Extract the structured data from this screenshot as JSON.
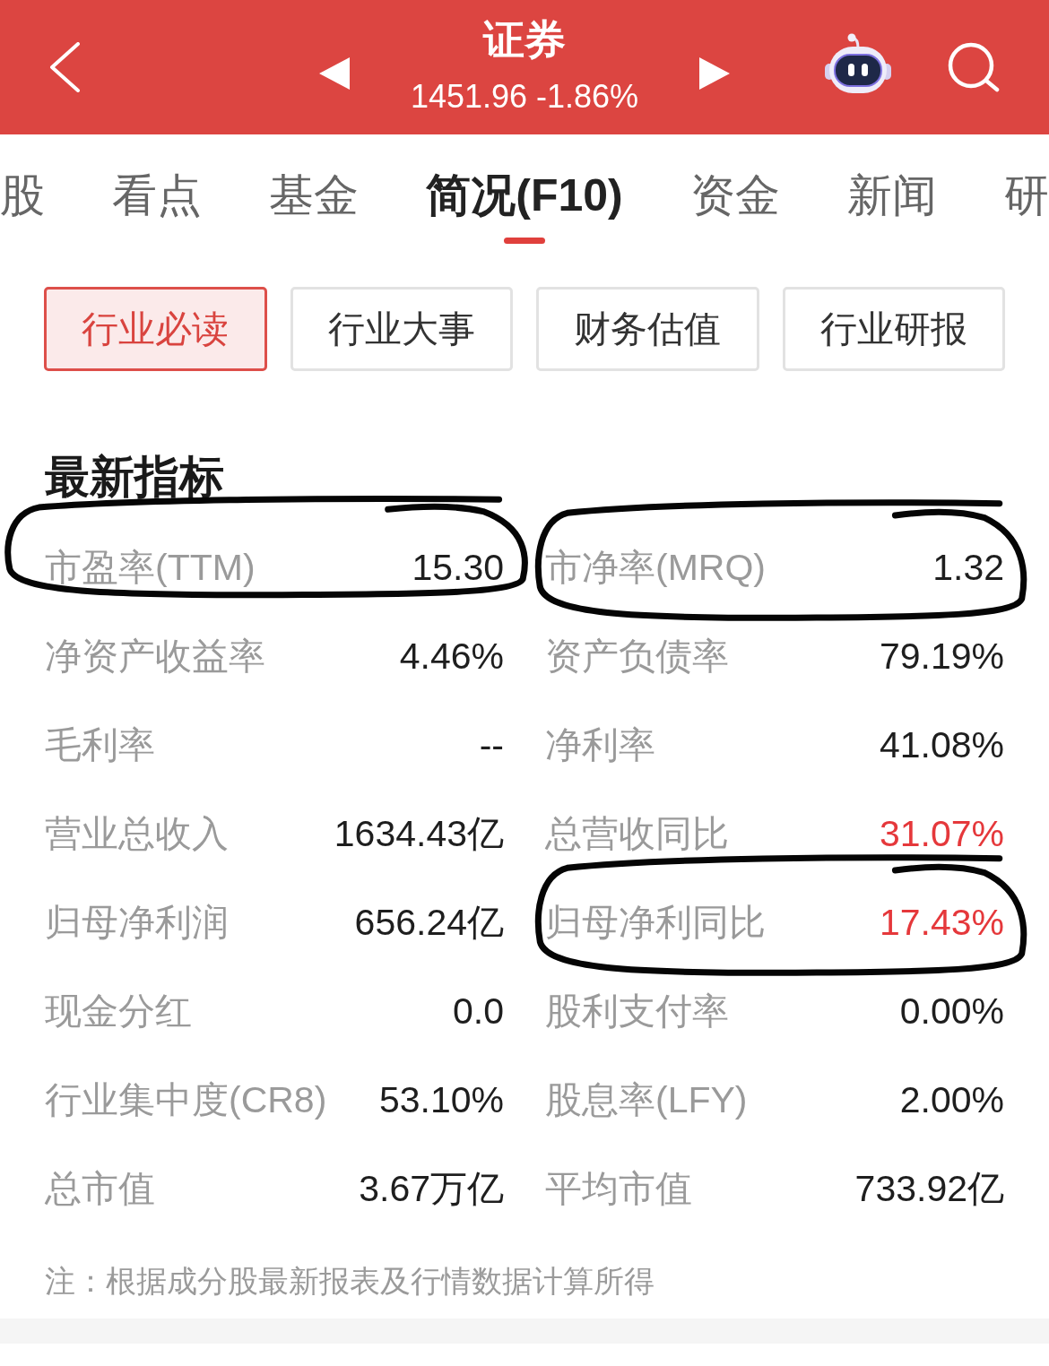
{
  "header": {
    "title": "证券",
    "quote": "1451.96 -1.86%"
  },
  "tabs": [
    {
      "label": "股",
      "selected": false
    },
    {
      "label": "看点",
      "selected": false
    },
    {
      "label": "基金",
      "selected": false
    },
    {
      "label": "简况(F10)",
      "selected": true
    },
    {
      "label": "资金",
      "selected": false
    },
    {
      "label": "新闻",
      "selected": false
    },
    {
      "label": "研",
      "selected": false
    }
  ],
  "sub_tabs": [
    {
      "label": "行业必读",
      "selected": true
    },
    {
      "label": "行业大事",
      "selected": false
    },
    {
      "label": "财务估值",
      "selected": false
    },
    {
      "label": "行业研报",
      "selected": false
    }
  ],
  "section": {
    "title": "最新指标",
    "metrics": [
      {
        "label": "市盈率(TTM)",
        "value": "15.30",
        "rising": false,
        "circled": true
      },
      {
        "label": "市净率(MRQ)",
        "value": "1.32",
        "rising": false,
        "circled": true
      },
      {
        "label": "净资产收益率",
        "value": "4.46%",
        "rising": false,
        "circled": false
      },
      {
        "label": "资产负债率",
        "value": "79.19%",
        "rising": false,
        "circled": false
      },
      {
        "label": "毛利率",
        "value": "--",
        "rising": false,
        "circled": false
      },
      {
        "label": "净利率",
        "value": "41.08%",
        "rising": false,
        "circled": false
      },
      {
        "label": "营业总收入",
        "value": "1634.43亿",
        "rising": false,
        "circled": false
      },
      {
        "label": "总营收同比",
        "value": "31.07%",
        "rising": true,
        "circled": false
      },
      {
        "label": "归母净利润",
        "value": "656.24亿",
        "rising": false,
        "circled": false
      },
      {
        "label": "归母净利同比",
        "value": "17.43%",
        "rising": true,
        "circled": true
      },
      {
        "label": "现金分红",
        "value": "0.0",
        "rising": false,
        "circled": false
      },
      {
        "label": "股利支付率",
        "value": "0.00%",
        "rising": false,
        "circled": false
      },
      {
        "label": "行业集中度(CR8)",
        "value": "53.10%",
        "rising": false,
        "circled": false
      },
      {
        "label": "股息率(LFY)",
        "value": "2.00%",
        "rising": false,
        "circled": false
      },
      {
        "label": "总市值",
        "value": "3.67万亿",
        "rising": false,
        "circled": false
      },
      {
        "label": "平均市值",
        "value": "733.92亿",
        "rising": false,
        "circled": false
      }
    ],
    "note": "注：根据成分股最新报表及行情数据计算所得"
  }
}
